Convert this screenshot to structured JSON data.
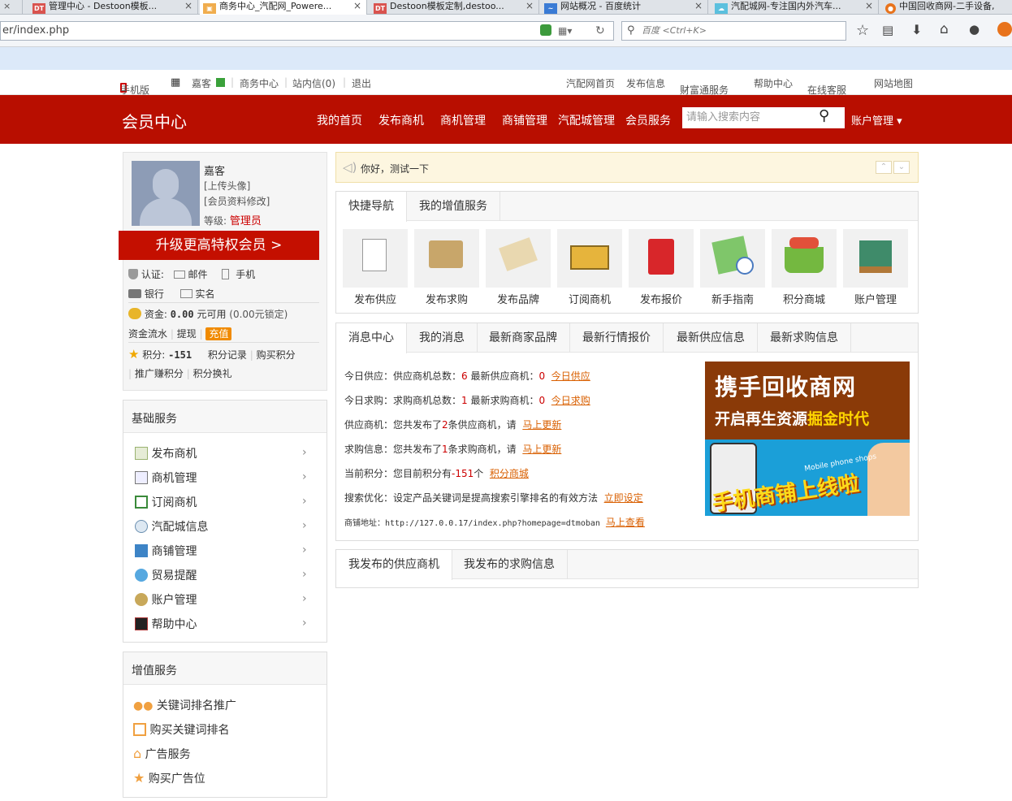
{
  "browser": {
    "tabs": [
      {
        "label": "管理中心 - Destoon模板...",
        "fav": "DT",
        "favcolor": "#d9534f"
      },
      {
        "label": "商务中心_汽配网_Powere...",
        "fav": "▣",
        "favcolor": "#f0ad4e"
      },
      {
        "label": "Destoon模板定制,destoo...",
        "fav": "DT",
        "favcolor": "#d9534f"
      },
      {
        "label": "网站概况 - 百度统计",
        "fav": "~",
        "favcolor": "#3a7bd5"
      },
      {
        "label": "汽配城网-专注国内外汽车...",
        "fav": "☁",
        "favcolor": "#5bc0de"
      },
      {
        "label": "中国回收商网-二手设备,",
        "fav": "●",
        "favcolor": "#e8731c"
      }
    ],
    "url": "er/index.php",
    "search_placeholder": "百度 <Ctrl+K>"
  },
  "topnav": {
    "mobile": "手机版",
    "user": "嘉客",
    "business_center": "商务中心",
    "inbox": "站内信(0)",
    "logout": "退出",
    "right": [
      "汽配网首页",
      "发布信息",
      "财富通服务",
      "帮助中心",
      "在线客服",
      "网站地图"
    ]
  },
  "header": {
    "logo": "会员中心",
    "nav": [
      "我的首页",
      "发布商机",
      "商机管理",
      "商铺管理",
      "汽配城管理",
      "会员服务"
    ],
    "search_placeholder": "请输入搜索内容",
    "account": "账户管理"
  },
  "profile": {
    "name": "嘉客",
    "upload_avatar": "[上传头像]",
    "edit_profile": "[会员资料修改]",
    "level_label": "等级:",
    "level": "管理员",
    "upgrade": "升级更高特权会员 >",
    "cert_label": "认证:",
    "email": "邮件",
    "phone": "手机",
    "bank": "银行",
    "realname": "实名",
    "funds_label": "资金:",
    "funds_value": "0.00",
    "funds_avail": "元可用",
    "funds_locked": "(0.00元锁定)",
    "funds_flow": "资金流水",
    "withdraw": "提现",
    "recharge": "充值",
    "points_label": "积分:",
    "points_value": "-151",
    "points_record": "积分记录",
    "buy_points": "购买积分",
    "promo_points": "推广赚积分",
    "points_gift": "积分换礼"
  },
  "basic_services": {
    "title": "基础服务",
    "items": [
      "发布商机",
      "商机管理",
      "订阅商机",
      "汽配城信息",
      "商铺管理",
      "贸易提醒",
      "账户管理",
      "帮助中心"
    ]
  },
  "vip_services": {
    "title": "增值服务",
    "items": [
      "关键词排名推广",
      "购买关键词排名",
      "广告服务",
      "购买广告位"
    ]
  },
  "notice": "你好，测试一下",
  "quicknav": {
    "tabs": [
      "快捷导航",
      "我的增值服务"
    ],
    "cards": [
      "发布供应",
      "发布求购",
      "发布品牌",
      "订阅商机",
      "发布报价",
      "新手指南",
      "积分商城",
      "账户管理"
    ]
  },
  "messages": {
    "tabs": [
      "消息中心",
      "我的消息",
      "最新商家品牌",
      "最新行情报价",
      "最新供应信息",
      "最新求购信息"
    ],
    "rows": [
      {
        "a": "今日供应：供应商机总数：",
        "n1": "6",
        "b": " 最新供应商机：",
        "n2": "0",
        "link": "今日供应"
      },
      {
        "a": "今日求购：求购商机总数：",
        "n1": "1",
        "b": " 最新求购商机：",
        "n2": "0",
        "link": "今日求购"
      },
      {
        "a": "供应商机：您共发布了",
        "n1": "2",
        "b": "条供应商机，请",
        "n2": "",
        "link": "马上更新"
      },
      {
        "a": "求购信息：您共发布了",
        "n1": "1",
        "b": "条求购商机，请",
        "n2": "",
        "link": "马上更新"
      },
      {
        "a": "当前积分：您目前积分有",
        "n1": "-151",
        "b": "个",
        "n2": "",
        "link": "积分商城"
      },
      {
        "a": "搜索优化：设定产品关键词是提高搜索引擎排名的有效方法",
        "n1": "",
        "b": "",
        "n2": "",
        "link": "立即设定"
      },
      {
        "a": "商铺地址：http://127.0.0.17/index.php?homepage=dtmoban",
        "n1": "",
        "b": "",
        "n2": "",
        "link": "马上查看"
      }
    ],
    "banner_title": "携手回收商网",
    "banner_sub1": "开启再生资源",
    "banner_sub2": "掘金时代",
    "banner_en": "Mobile phone shops",
    "banner_slogan": "手机商铺上线啦"
  },
  "mylistings": {
    "tabs": [
      "我发布的供应商机",
      "我发布的求购信息"
    ]
  },
  "colors": {
    "brand_red": "#b80e00",
    "link_orange": "#d95f00"
  }
}
